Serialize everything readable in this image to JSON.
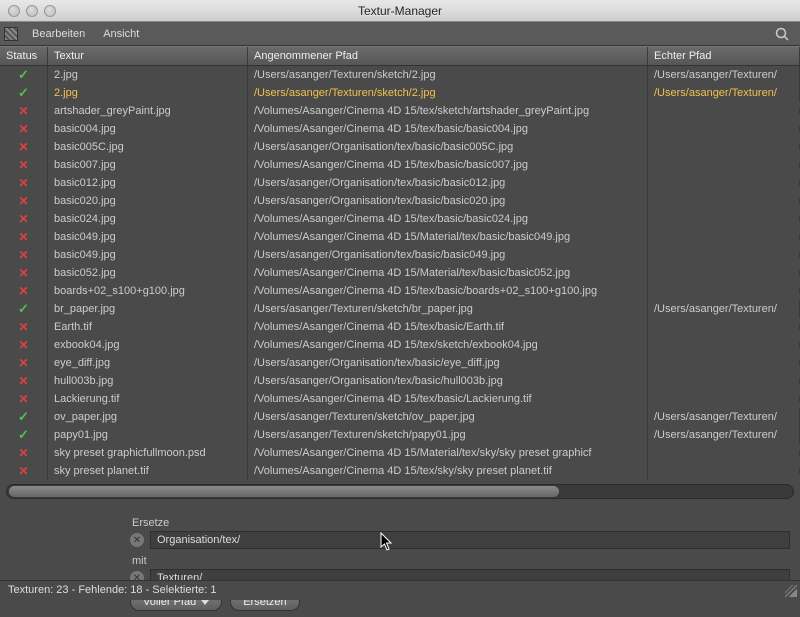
{
  "window": {
    "title": "Textur-Manager"
  },
  "menus": {
    "edit": "Bearbeiten",
    "view": "Ansicht"
  },
  "columns": {
    "status": "Status",
    "texture": "Textur",
    "assumed": "Angenommener Pfad",
    "real": "Echter Pfad"
  },
  "rows": [
    {
      "ok": true,
      "tex": "2.jpg",
      "path": "/Users/asanger/Texturen/sketch/2.jpg",
      "real": "/Users/asanger/Texturen/",
      "sel": false
    },
    {
      "ok": true,
      "tex": "2.jpg",
      "path": "/Users/asanger/Texturen/sketch/2.jpg",
      "real": "/Users/asanger/Texturen/",
      "sel": true
    },
    {
      "ok": false,
      "tex": "artshader_greyPaint.jpg",
      "path": "/Volumes/Asanger/Cinema 4D 15/tex/sketch/artshader_greyPaint.jpg",
      "real": ""
    },
    {
      "ok": false,
      "tex": "basic004.jpg",
      "path": "/Volumes/Asanger/Cinema 4D 15/tex/basic/basic004.jpg",
      "real": ""
    },
    {
      "ok": false,
      "tex": "basic005C.jpg",
      "path": "/Users/asanger/Organisation/tex/basic/basic005C.jpg",
      "real": ""
    },
    {
      "ok": false,
      "tex": "basic007.jpg",
      "path": "/Volumes/Asanger/Cinema 4D 15/tex/basic/basic007.jpg",
      "real": ""
    },
    {
      "ok": false,
      "tex": "basic012.jpg",
      "path": "/Users/asanger/Organisation/tex/basic/basic012.jpg",
      "real": ""
    },
    {
      "ok": false,
      "tex": "basic020.jpg",
      "path": "/Users/asanger/Organisation/tex/basic/basic020.jpg",
      "real": ""
    },
    {
      "ok": false,
      "tex": "basic024.jpg",
      "path": "/Volumes/Asanger/Cinema 4D 15/tex/basic/basic024.jpg",
      "real": ""
    },
    {
      "ok": false,
      "tex": "basic049.jpg",
      "path": "/Volumes/Asanger/Cinema 4D 15/Material/tex/basic/basic049.jpg",
      "real": ""
    },
    {
      "ok": false,
      "tex": "basic049.jpg",
      "path": "/Users/asanger/Organisation/tex/basic/basic049.jpg",
      "real": ""
    },
    {
      "ok": false,
      "tex": "basic052.jpg",
      "path": "/Volumes/Asanger/Cinema 4D 15/Material/tex/basic/basic052.jpg",
      "real": ""
    },
    {
      "ok": false,
      "tex": "boards+02_s100+g100.jpg",
      "path": "/Volumes/Asanger/Cinema 4D 15/tex/basic/boards+02_s100+g100.jpg",
      "real": ""
    },
    {
      "ok": true,
      "tex": "br_paper.jpg",
      "path": "/Users/asanger/Texturen/sketch/br_paper.jpg",
      "real": "/Users/asanger/Texturen/"
    },
    {
      "ok": false,
      "tex": "Earth.tif",
      "path": "/Volumes/Asanger/Cinema 4D 15/tex/basic/Earth.tif",
      "real": ""
    },
    {
      "ok": false,
      "tex": "exbook04.jpg",
      "path": "/Volumes/Asanger/Cinema 4D 15/tex/sketch/exbook04.jpg",
      "real": ""
    },
    {
      "ok": false,
      "tex": "eye_diff.jpg",
      "path": "/Users/asanger/Organisation/tex/basic/eye_diff.jpg",
      "real": ""
    },
    {
      "ok": false,
      "tex": "hull003b.jpg",
      "path": "/Users/asanger/Organisation/tex/basic/hull003b.jpg",
      "real": ""
    },
    {
      "ok": false,
      "tex": "Lackierung.tif",
      "path": "/Volumes/Asanger/Cinema 4D 15/tex/basic/Lackierung.tif",
      "real": ""
    },
    {
      "ok": true,
      "tex": "ov_paper.jpg",
      "path": "/Users/asanger/Texturen/sketch/ov_paper.jpg",
      "real": "/Users/asanger/Texturen/"
    },
    {
      "ok": true,
      "tex": "papy01.jpg",
      "path": "/Users/asanger/Texturen/sketch/papy01.jpg",
      "real": "/Users/asanger/Texturen/"
    },
    {
      "ok": false,
      "tex": "sky preset graphicfullmoon.psd",
      "path": "/Volumes/Asanger/Cinema 4D 15/Material/tex/sky/sky preset graphicf",
      "real": ""
    },
    {
      "ok": false,
      "tex": "sky preset planet.tif",
      "path": "/Volumes/Asanger/Cinema 4D 15/tex/sky/sky preset planet.tif",
      "real": ""
    }
  ],
  "form": {
    "replace_label": "Ersetze",
    "with_label": "mit",
    "replace_value": "Organisation/tex/",
    "with_value": "Texturen/",
    "mode": "Voller Pfad",
    "button": "Ersetzen"
  },
  "status": "Texturen: 23 - Fehlende: 18 - Selektierte: 1"
}
